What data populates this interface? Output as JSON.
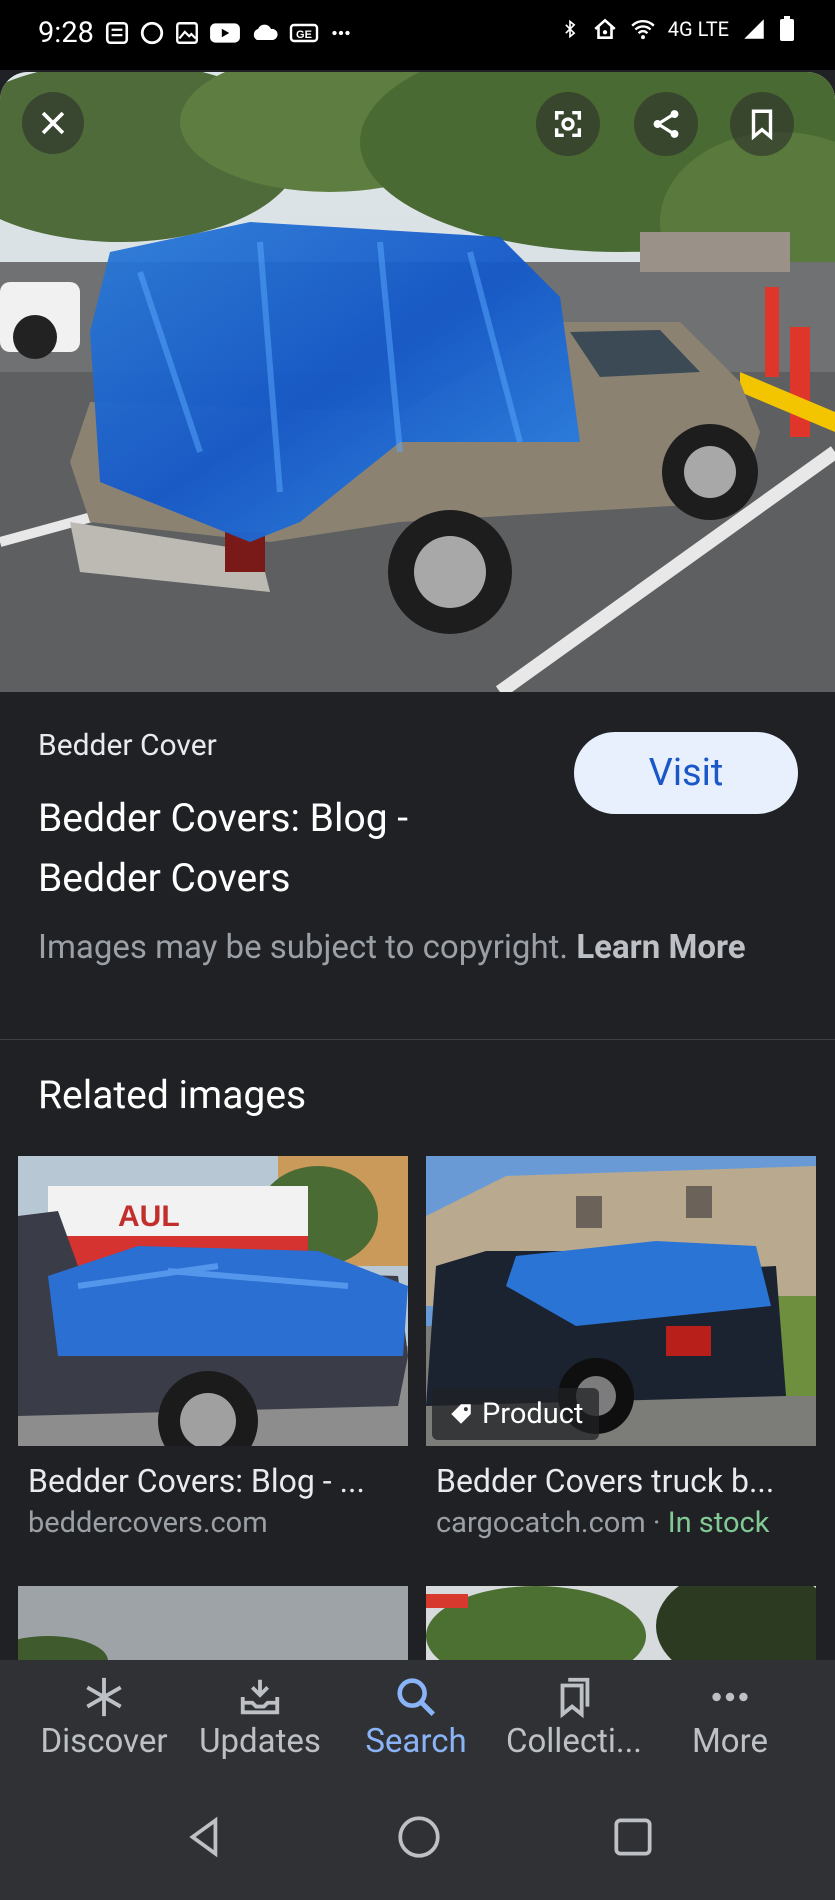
{
  "status_bar": {
    "time": "9:28",
    "network": "4G LTE",
    "left_icons": [
      "news-icon",
      "circle-icon",
      "gallery-icon",
      "youtube-icon",
      "cloud-icon",
      "ge-icon",
      "more-dots-icon"
    ],
    "right_icons": [
      "bluetooth-icon",
      "hotspot-icon",
      "wifi-icon",
      "signal-icon",
      "battery-icon"
    ]
  },
  "hero": {
    "buttons": [
      "close-icon",
      "lens-icon",
      "share-icon",
      "bookmark-icon"
    ]
  },
  "result": {
    "source": "Bedder Cover",
    "title": "Bedder Covers: Blog - Bedder Covers",
    "visit_label": "Visit",
    "copyright_text": "Images may be subject to copyright.",
    "learn_more": "Learn More"
  },
  "related": {
    "heading": "Related images",
    "items": [
      {
        "title": "Bedder Covers: Blog - ...",
        "site": "beddercovers.com"
      },
      {
        "title": "Bedder Covers truck b...",
        "site": "cargocatch.com",
        "separator": " · ",
        "stock": "In stock",
        "badge": "Product"
      }
    ]
  },
  "bottom_nav": [
    {
      "label": "Discover",
      "icon": "asterisk-icon"
    },
    {
      "label": "Updates",
      "icon": "inbox-icon"
    },
    {
      "label": "Search",
      "icon": "search-icon",
      "active": true
    },
    {
      "label": "Collecti...",
      "icon": "collections-icon"
    },
    {
      "label": "More",
      "icon": "more-icon"
    }
  ],
  "colors": {
    "background": "#202124",
    "accent": "#8ab4f8",
    "visit_bg": "#e8f0fe",
    "visit_text": "#1a57c7",
    "stock_green": "#81c995"
  }
}
